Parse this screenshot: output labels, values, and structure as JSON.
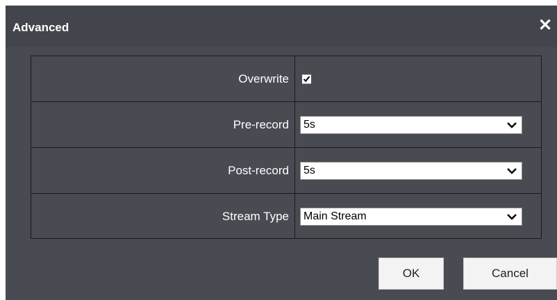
{
  "dialog": {
    "title": "Advanced",
    "close_icon": "close-icon"
  },
  "fields": {
    "overwrite": {
      "label": "Overwrite",
      "checked": true,
      "icon": "checkmark-icon"
    },
    "pre_record": {
      "label": "Pre-record",
      "value": "5s",
      "icon": "chevron-down-icon"
    },
    "post_record": {
      "label": "Post-record",
      "value": "5s",
      "icon": "chevron-down-icon"
    },
    "stream_type": {
      "label": "Stream Type",
      "value": "Main Stream",
      "icon": "chevron-down-icon"
    }
  },
  "buttons": {
    "ok": "OK",
    "cancel": "Cancel"
  },
  "colors": {
    "dialog_bg": "#484b52",
    "titlebar_bg": "#42454b",
    "border": "#1a1a1a",
    "text": "#ffffff"
  }
}
